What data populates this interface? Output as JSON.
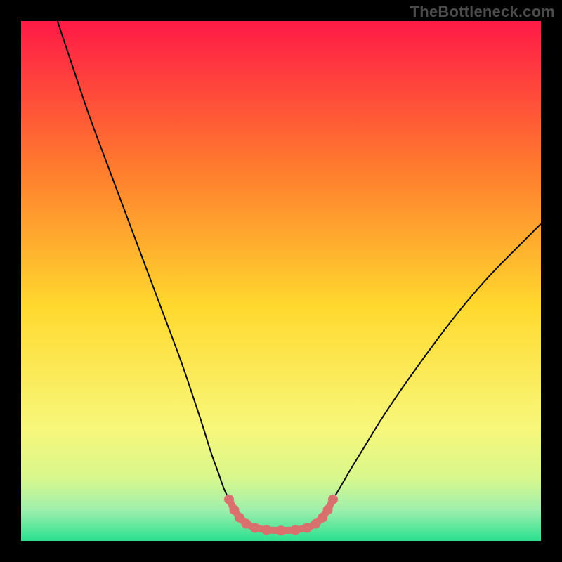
{
  "watermark": "TheBottleneck.com",
  "chart_data": {
    "type": "line",
    "title": "",
    "xlabel": "",
    "ylabel": "",
    "xlim": [
      0,
      100
    ],
    "ylim": [
      0,
      100
    ],
    "grid": false,
    "legend": false,
    "background_gradient": {
      "top": "#ff1a47",
      "mid_upper": "#ff7a2e",
      "mid": "#ffd92e",
      "mid_lower": "#f8f77a",
      "low1": "#d8f78c",
      "low2": "#9fefad",
      "bottom": "#29e18f"
    },
    "series": [
      {
        "name": "bottleneck-curve",
        "color": "#0a0a0a",
        "width": 2,
        "x": [
          7,
          10,
          13,
          16,
          19,
          22,
          25,
          28,
          31,
          33,
          35,
          36.5,
          38,
          39,
          40,
          41.3,
          42.5,
          44.5,
          47.5,
          52.5,
          55.5,
          57.5,
          58.8,
          60,
          61.5,
          63.5,
          66,
          69,
          73,
          78,
          84,
          90,
          96,
          100
        ],
        "y": [
          100,
          91,
          82,
          74,
          66,
          58,
          50,
          42,
          34,
          28,
          22,
          17,
          13,
          10,
          8,
          6,
          4.5,
          3,
          2.2,
          2.2,
          3,
          4.5,
          6,
          8,
          10.5,
          14,
          18,
          23,
          29,
          36,
          44,
          51,
          57,
          61
        ]
      }
    ],
    "highlight_trough": {
      "color": "#d9706e",
      "dot_radius": 7,
      "line_width": 10,
      "points_x": [
        40.0,
        41.0,
        42.0,
        43.3,
        45.0,
        47.2,
        50.0,
        52.8,
        55.0,
        56.7,
        58.0,
        59.0,
        60.0
      ],
      "points_y": [
        8.0,
        6.0,
        4.5,
        3.3,
        2.5,
        2.1,
        2.0,
        2.1,
        2.5,
        3.3,
        4.5,
        6.0,
        8.0
      ]
    }
  }
}
